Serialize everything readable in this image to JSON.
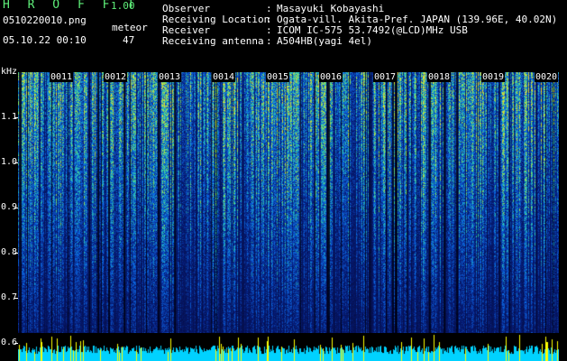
{
  "app": {
    "title": "H R O F F T",
    "version": "1.00"
  },
  "file": {
    "name": "0510220010.png",
    "datetime": "05.10.22 00:10"
  },
  "meteor": {
    "label": "meteor",
    "count": "47"
  },
  "meta": [
    {
      "key": "Observer",
      "sep": ":",
      "value": "Masayuki Kobayashi"
    },
    {
      "key": "Receiving Location",
      "sep": ":",
      "value": "Ogata-vill. Akita-Pref. JAPAN (139.96E, 40.02N)"
    },
    {
      "key": "Receiver",
      "sep": ":",
      "value": "ICOM IC-575 53.7492(@LCD)MHz USB"
    },
    {
      "key": "Receiving antenna",
      "sep": ":",
      "value": "A504HB(yagi 4el)"
    }
  ],
  "axis": {
    "unit": "kHz",
    "ticks": [
      "1.1",
      "1.0",
      "0.9",
      "0.8",
      "0.7",
      "0.6"
    ],
    "tick_values": [
      1.1,
      1.0,
      0.9,
      0.8,
      0.7,
      0.6
    ]
  },
  "minutes": [
    "0011",
    "0012",
    "0013",
    "0014",
    "0015",
    "0016",
    "0017",
    "0018",
    "0019",
    "0020"
  ],
  "colors": {
    "title": "#5ff07a",
    "spectrum_dark": "#08105a",
    "spectrum_mid": "#1e46c8",
    "spectrum_hot": "#28d2a0",
    "spectrum_peak": "#f0f050",
    "level_base": "#00d2ff",
    "level_peak": "#ffff00"
  }
}
